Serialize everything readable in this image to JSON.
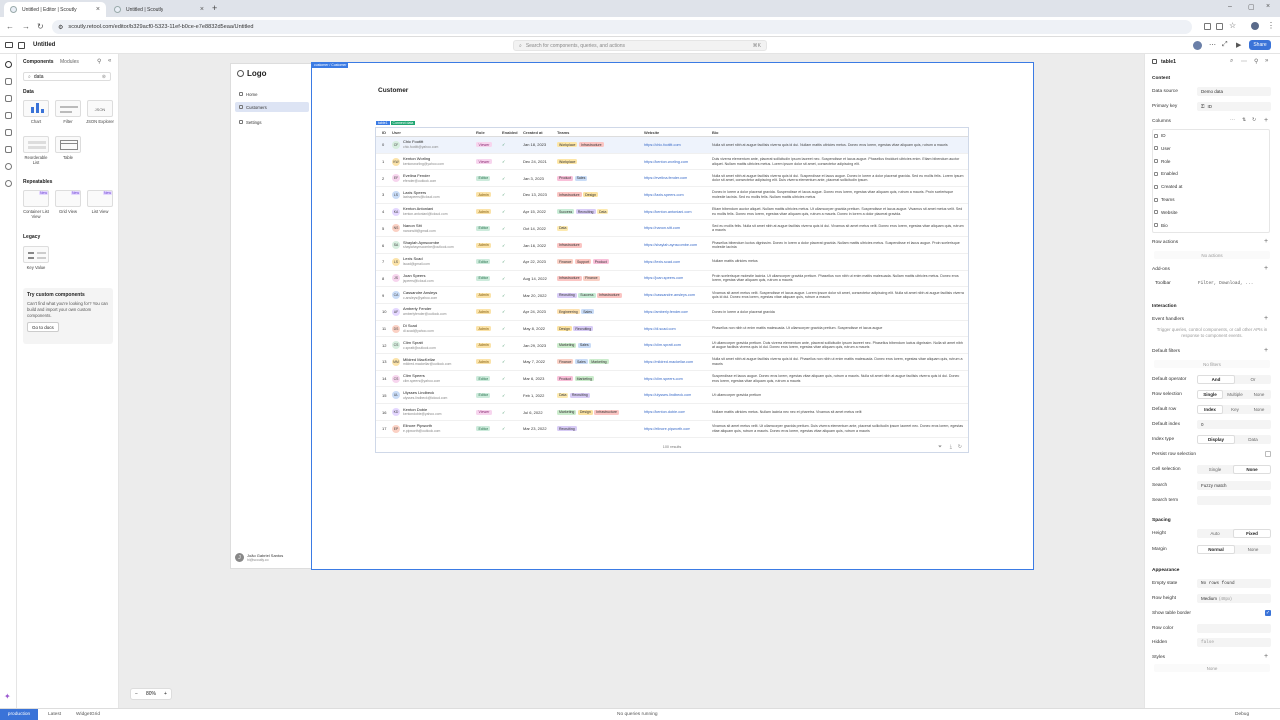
{
  "browser": {
    "tabs": [
      {
        "title": "Untitled | Editor | Scoutly",
        "active": true
      },
      {
        "title": "Untitled | Scoutly",
        "active": false
      }
    ],
    "url": "scoutly.retool.com/editor/b329acf0-5323-11ef-b0ce-e7e8832d5eaa/Untitled"
  },
  "app_header": {
    "app_name": "Untitled",
    "search_placeholder": "Search for components, queries, and actions",
    "search_shortcut": "⌘K",
    "share_label": "Share"
  },
  "left_panel": {
    "tabs": [
      "Components",
      "Modules"
    ],
    "search_value": "data",
    "sections": [
      {
        "title": "Data",
        "items": [
          {
            "label": "Chart"
          },
          {
            "label": "Filter"
          },
          {
            "label": "JSON Explorer"
          },
          {
            "label": "Reorderable List"
          },
          {
            "label": "Table"
          }
        ]
      },
      {
        "title": "Repeatables",
        "items": [
          {
            "label": "Container List View",
            "new": "New"
          },
          {
            "label": "Grid View",
            "new": "New"
          },
          {
            "label": "List View",
            "new": "New"
          }
        ]
      },
      {
        "title": "Legacy",
        "items": [
          {
            "label": "Key Value"
          }
        ]
      }
    ],
    "custom": {
      "title": "Try custom components",
      "desc": "Can't find what you're looking for? You can build and import your own custom components.",
      "button": "Go to docs"
    }
  },
  "app_preview": {
    "logo": "Logo",
    "nav": [
      {
        "label": "Home",
        "active": false
      },
      {
        "label": "Customers",
        "active": true
      },
      {
        "label": "Settings",
        "active": false
      }
    ],
    "user_name": "João Gabriel Santos",
    "user_email": "hi@scoutly.co",
    "user_initial": "J",
    "frame_tag": "customer / Customer",
    "page_title": "Customer",
    "table_tag": "table1",
    "connect_tag": "Connect data"
  },
  "table": {
    "headers": [
      "ID",
      "User",
      "Role",
      "Enabled",
      "Created at",
      "Teams",
      "Website",
      "Bio"
    ],
    "rows": [
      {
        "id": "0",
        "initials": "CF",
        "name": "Chic Footitt",
        "email": "chic.footitt@yahoo.com",
        "role": "Viewer",
        "enabled": "✓",
        "created": "Jan 18, 2023",
        "teams": [
          "Workplace",
          "Infrastructure"
        ],
        "website": "https://chic.footitt.com",
        "bio": "Nulla sit amet nibh at augue facilisis viverra quis id dui. Nullam mattis ultricies metus. Donec eros lorem, egestas vitae aliquam quis, rutrum a mauris"
      },
      {
        "id": "1",
        "initials": "KW",
        "name": "Kenton Worling",
        "email": "kentonworling@yahoo.com",
        "role": "Viewer",
        "enabled": "✓",
        "created": "Dec 24, 2021",
        "teams": [
          "Workplace"
        ],
        "website": "https://kenton.worling.com",
        "bio": "Duis viverra elementum ante, placerat sollicitudin ipsum laoreet nec. Suspendisse et lacus augue. Phasellus tincidunt ultricies enim. Etiam bibendum auctor aliquet. Nullam mattis ultricies metus. Lorem ipsum dolor sit amet, consectetur adipiscing elit."
      },
      {
        "id": "2",
        "initials": "EF",
        "name": "Evelina Fender",
        "email": "efender@outlook.com",
        "role": "Editor",
        "enabled": "✓",
        "created": "Jan 3, 2023",
        "teams": [
          "Product",
          "Sales"
        ],
        "website": "https://evelina.fender.com",
        "bio": "Nulla sit amet nibh at augue facilisis viverra quis id dui. Suspendisse et lacus augue. Donec in lorem a dolor placerat gravida. Sed eu mollis felis. Lorem ipsum dolor sit amet, consectetur adipiscing elit. Duis viverra elementum ante, placerat sollicitudin ipsum."
      },
      {
        "id": "3",
        "initials": "LS",
        "name": "Laxis Speers",
        "email": "laxisspeers@icloud.com",
        "role": "Admin",
        "enabled": "✓",
        "created": "Dec 13, 2023",
        "teams": [
          "Infrastructure",
          "Design"
        ],
        "website": "https://laxis.speers.com",
        "bio": "Donec in lorem a dolor placerat gravida. Suspendisse et lacus augue. Donec eros lorem, egestas vitae aliquam quis, rutrum a mauris. Proin scelerisque molestie lacinia. Sed eu mollis felis. Nullam mattis ultricies metus"
      },
      {
        "id": "4",
        "initials": "KA",
        "name": "Kenton Antoniani",
        "email": "kenton.antoniani@icloud.com",
        "role": "Admin",
        "enabled": "✓",
        "created": "Apr 15, 2022",
        "teams": [
          "Success",
          "Recruiting",
          "Data"
        ],
        "website": "https://kenton.antoniani.com",
        "bio": "Etiam bibendum auctor aliquet. Nullam mattis ultricies metus. Ut ullamcorper gravida pretium. Suspendisse et lacus augue. Vivamus sit amet metus velit. Sed eu mollis felis. Donec eros lorem, egestas vitae aliquam quis, rutrum a mauris. Donec in lorem a dolor placerat gravida."
      },
      {
        "id": "5",
        "initials": "NS",
        "name": "Nanon Sitt",
        "email": "nanonsitt@gmail.com",
        "role": "Editor",
        "enabled": "✓",
        "created": "Oct 14, 2022",
        "teams": [
          "Data"
        ],
        "website": "https://nanon.sitt.com",
        "bio": "Sed eu mollis felis. Nulla sit amet nibh at augue facilisis viverra quis id dui. Vivamus sit amet metus velit. Donec eros lorem, egestas vitae aliquam quis, rutrum a mauris"
      },
      {
        "id": "6",
        "initials": "SA",
        "name": "Shaylah Aynscombe",
        "email": "shaylahaynscombe@outlook.com",
        "role": "Admin",
        "enabled": "✓",
        "created": "Jan 16, 2022",
        "teams": [
          "Infrastructure"
        ],
        "website": "https://shaylah.aynscombe.com",
        "bio": "Phasellus bibendum luctus dignissim. Donec in lorem a dolor placerat gravida. Nullam mattis ultricies metus. Suspendisse et lacus augue. Proin scelerisque molestie lacinia"
      },
      {
        "id": "7",
        "initials": "LS",
        "name": "Lexis Scad",
        "email": "lscad@gmail.com",
        "role": "Editor",
        "enabled": "✓",
        "created": "Apr 22, 2023",
        "teams": [
          "Finance",
          "Support",
          "Product"
        ],
        "website": "https://lexis.scad.com",
        "bio": "Nullam mattis ultricies metus"
      },
      {
        "id": "8",
        "initials": "JS",
        "name": "Joan Speers",
        "email": "jspeers@icloud.com",
        "role": "Editor",
        "enabled": "✓",
        "created": "Aug 14, 2022",
        "teams": [
          "Infrastructure",
          "Finance"
        ],
        "website": "https://joan.speers.com",
        "bio": "Proin scelerisque molestie lacinia. Ut ullamcorper gravida pretium. Phasellus non nibh ut enim mattis malesuada. Nullam mattis ultricies metus. Donec eros lorem, egestas vitae aliquam quis, rutrum a mauris"
      },
      {
        "id": "9",
        "initials": "CA",
        "name": "Cassandre Ansleys",
        "email": "c.ansleys@yahoo.com",
        "role": "Admin",
        "enabled": "✓",
        "created": "Mar 20, 2022",
        "teams": [
          "Recruiting",
          "Success",
          "Infrastructure"
        ],
        "website": "https://cassandre.ansleys.com",
        "bio": "Vivamus sit amet metus velit. Suspendisse et lacus augue. Lorem ipsum dolor sit amet, consectetur adipiscing elit. Nulla sit amet nibh at augue facilisis viverra quis id dui. Donec eros lorem, egestas vitae aliquam quis, rutrum a mauris"
      },
      {
        "id": "10",
        "initials": "AF",
        "name": "Amberly Fender",
        "email": "amberlyfender@outlook.com",
        "role": "Admin",
        "enabled": "✓",
        "created": "Apr 24, 2023",
        "teams": [
          "Engineering",
          "Sales"
        ],
        "website": "https://amberly.fender.com",
        "bio": "Donec in lorem a dolor placerat gravida"
      },
      {
        "id": "11",
        "initials": "DS",
        "name": "Di Scad",
        "email": "di.scad@yahoo.com",
        "role": "Admin",
        "enabled": "✓",
        "created": "May 8, 2022",
        "teams": [
          "Design",
          "Recruiting"
        ],
        "website": "https://di.scad.com",
        "bio": "Phasellus non nibh ut enim mattis malesuada. Ut ullamcorper gravida pretium. Suspendisse et lacus augue"
      },
      {
        "id": "12",
        "initials": "CS",
        "name": "Clim Spratt",
        "email": "c.spratt@outlook.com",
        "role": "Admin",
        "enabled": "✓",
        "created": "Jan 29, 2023",
        "teams": [
          "Marketing",
          "Sales"
        ],
        "website": "https://clim.spratt.com",
        "bio": "Ut ullamcorper gravida pretium. Duis viverra elementum ante, placerat sollicitudin ipsum laoreet nec. Phasellus bibendum luctus dignissim. Nulla sit amet nibh at augue facilisis viverra quis id dui. Donec eros lorem, egestas vitae aliquam quis, rutrum a mauris"
      },
      {
        "id": "13",
        "initials": "MM",
        "name": "Mildred MacKellar",
        "email": "mildred.mackellar@outlook.com",
        "role": "Admin",
        "enabled": "✓",
        "created": "May 7, 2022",
        "teams": [
          "Finance",
          "Sales",
          "Marketing"
        ],
        "website": "https://mildred.mackellar.com",
        "bio": "Nulla sit amet nibh at augue facilisis viverra quis id dui. Phasellus non nibh ut enim mattis malesuada. Donec eros lorem, egestas vitae aliquam quis, rutrum a mauris"
      },
      {
        "id": "14",
        "initials": "CS",
        "name": "Clim Speers",
        "email": "clim.speers@yahoo.com",
        "role": "Editor",
        "enabled": "✓",
        "created": "Mar 6, 2023",
        "teams": [
          "Product",
          "Marketing"
        ],
        "website": "https://clim.speers.com",
        "bio": "Suspendisse et lacus augue. Donec eros lorem, egestas vitae aliquam quis, rutrum a mauris. Nulla sit amet nibh at augue facilisis viverra quis id dui. Donec eros lorem, egestas vitae aliquam quis, rutrum a mauris"
      },
      {
        "id": "15",
        "initials": "UL",
        "name": "Ulysses Lindbeck",
        "email": "ulysses.lindbeck@icloud.com",
        "role": "Editor",
        "enabled": "✓",
        "created": "Feb 1, 2022",
        "teams": [
          "Data",
          "Recruiting"
        ],
        "website": "https://ulysses.lindbeck.com",
        "bio": "Ut ullamcorper gravida pretium"
      },
      {
        "id": "16",
        "initials": "KD",
        "name": "Kenton Dobie",
        "email": "kentondobie@yahoo.com",
        "role": "Viewer",
        "enabled": "✓",
        "created": "Jul 6, 2022",
        "teams": [
          "Marketing",
          "Design",
          "Infrastructure"
        ],
        "website": "https://kenton.dobie.com",
        "bio": "Nullam mattis ultricies metus. Nullam lacinia nec nec et pharetra. Vivamus sit amet metus velit"
      },
      {
        "id": "17",
        "initials": "EP",
        "name": "Elinore Pipworth",
        "email": "e.pipworth@outlook.com",
        "role": "Editor",
        "enabled": "✓",
        "created": "Mar 23, 2022",
        "teams": [
          "Recruiting"
        ],
        "website": "https://elinore.pipworth.com",
        "bio": "Vivamus sit amet metus velit. Ut ullamcorper gravida pretium. Duis viverra elementum ante, placerat sollicitudin ipsum laoreet nec. Donec eros lorem, egestas vitae aliquam quis, rutrum a mauris. Donec eros lorem, egestas vitae aliquam quis, rutrum a mauris"
      }
    ],
    "footer": "100 results"
  },
  "zoom": {
    "value": "80%",
    "minus": "−",
    "plus": "+"
  },
  "inspector": {
    "component_name": "table1",
    "content_title": "Content",
    "data_source_label": "Data source",
    "data_source_value": "Demo data",
    "primary_key_label": "Primary key",
    "primary_key_value": "ID",
    "columns_label": "Columns",
    "columns": [
      "ID",
      "User",
      "Role",
      "Enabled",
      "Created at",
      "Teams",
      "Website",
      "Bio"
    ],
    "row_actions_label": "Row actions",
    "no_actions": "No actions",
    "addons_label": "Add-ons",
    "toolbar_label": "Toolbar",
    "toolbar_value": "Filter, Download, ...",
    "interaction_title": "Interaction",
    "event_handlers_label": "Event handlers",
    "event_handlers_hint": "Trigger queries, control components, or call other APIs in response to component events.",
    "default_filters_label": "Default filters",
    "no_filters": "No filters",
    "default_operator_label": "Default operator",
    "default_operator_opts": [
      "And",
      "Or"
    ],
    "row_selection_label": "Row selection",
    "row_selection_opts": [
      "Single",
      "Multiple",
      "None"
    ],
    "default_row_label": "Default row",
    "default_row_opts": [
      "Index",
      "Key",
      "None"
    ],
    "default_index_label": "Default index",
    "default_index_value": "0",
    "index_type_label": "Index type",
    "index_type_opts": [
      "Display",
      "Data"
    ],
    "persist_label": "Persist row selection",
    "cell_selection_label": "Cell selection",
    "cell_selection_opts": [
      "Single",
      "None"
    ],
    "search_label": "Search",
    "search_value": "Fuzzy match",
    "search_term_label": "Search term",
    "spacing_title": "Spacing",
    "height_label": "Height",
    "height_opts": [
      "Auto",
      "Fixed"
    ],
    "margin_label": "Margin",
    "margin_opts": [
      "Normal",
      "None"
    ],
    "appearance_title": "Appearance",
    "empty_state_label": "Empty state",
    "empty_state_value": "No rows found",
    "row_height_label": "Row height",
    "row_height_value": "Medium",
    "row_height_hint": "(48px)",
    "show_border_label": "Show table border",
    "row_color_label": "Row color",
    "hidden_label": "Hidden",
    "hidden_value": "false",
    "styles_label": "Styles",
    "styles_value": "None"
  },
  "status": {
    "env": "production",
    "latest": "Latest",
    "widget": "WidgetGrid",
    "queries": "No queries running",
    "debug": "Debug"
  },
  "colors": {
    "accent": "#3a73d8",
    "selection": "#3b7be4"
  }
}
